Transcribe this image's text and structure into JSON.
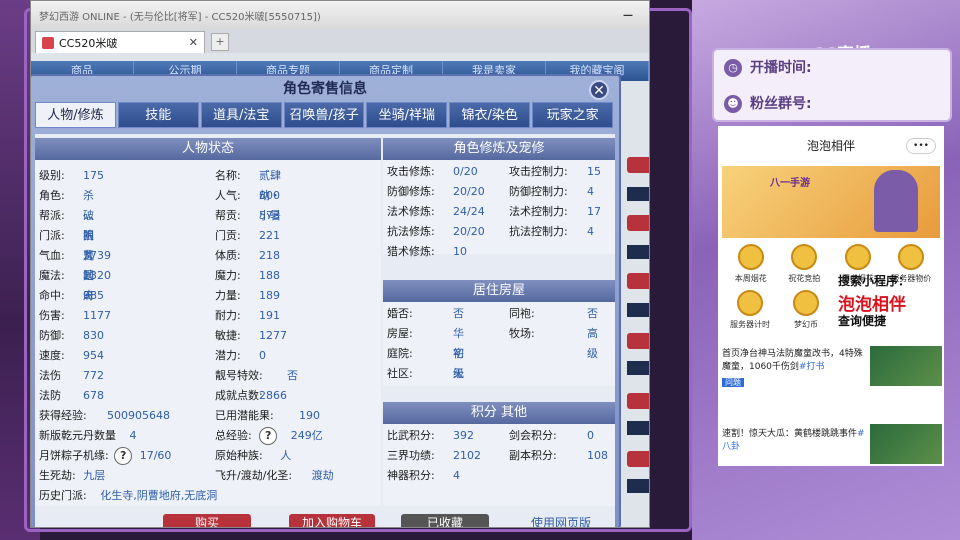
{
  "window": {
    "title": "梦幻西游 ONLINE - (无与伦比[将军] - CC520米啵[5550715])",
    "min_label": "—",
    "tab_label": "CC520米啵",
    "tab_close": "✕",
    "new_tab": "+"
  },
  "nav": [
    "商品",
    "公示期",
    "商品专题",
    "商品定制",
    "我是卖家",
    "我的藏宝阁"
  ],
  "dialog": {
    "title": "角色寄售信息",
    "close": "✕",
    "tabs": [
      "人物/修炼",
      "技能",
      "道具/法宝",
      "召唤兽/孩子",
      "坐骑/祥瑞",
      "锦衣/染色",
      "玩家之家"
    ]
  },
  "status": {
    "header": "人物状态",
    "left": [
      [
        "级别:",
        "175"
      ],
      [
        "角色:",
        "杀破狼"
      ],
      [
        "帮派:",
        "灬凼儿园ミ"
      ],
      [
        "门派:",
        "阴曹地府"
      ],
      [
        "气血:",
        "3739"
      ],
      [
        "魔法:",
        "1320"
      ],
      [
        "命中:",
        "985"
      ],
      [
        "伤害:",
        "1177"
      ],
      [
        "防御:",
        "830"
      ],
      [
        "速度:",
        "954"
      ],
      [
        "法伤",
        "772"
      ],
      [
        "法防",
        "678"
      ],
      [
        "获得经验:",
        "500905648"
      ]
    ],
    "right": [
      [
        "名称:",
        "贰肆劫・小暑"
      ],
      [
        "人气:",
        "800"
      ],
      [
        "帮贡:",
        "573"
      ],
      [
        "门贡:",
        "221"
      ],
      [
        "体质:",
        "218"
      ],
      [
        "魔力:",
        "188"
      ],
      [
        "力量:",
        "189"
      ],
      [
        "耐力:",
        "191"
      ],
      [
        "敏捷:",
        "1277"
      ],
      [
        "潜力:",
        "0"
      ],
      [
        "靓号特效:",
        "否"
      ],
      [
        "成就点数:",
        "2866"
      ],
      [
        "已用潜能果:",
        "190"
      ]
    ],
    "extra": [
      [
        "新版乾元丹数量",
        "4"
      ],
      [
        "总经验:",
        "249亿"
      ],
      [
        "月饼粽子机缘:",
        "17/60"
      ],
      [
        "原始种族:",
        "人"
      ],
      [
        "生死劫:",
        "九层"
      ],
      [
        "飞升/渡劫/化圣:",
        "渡劫"
      ]
    ],
    "history_label": "历史门派:",
    "history_value": "化生寺,阴曹地府,无底洞"
  },
  "cultivation": {
    "header": "角色修炼及宠修",
    "rows": [
      [
        "攻击修炼:",
        "0/20",
        "攻击控制力:",
        "15"
      ],
      [
        "防御修炼:",
        "20/20",
        "防御控制力:",
        "4"
      ],
      [
        "法术修炼:",
        "24/24",
        "法术控制力:",
        "17"
      ],
      [
        "抗法修炼:",
        "20/20",
        "抗法控制力:",
        "4"
      ],
      [
        "猎术修炼:",
        "10",
        "",
        ""
      ]
    ]
  },
  "housing": {
    "header": "居住房屋",
    "rows": [
      [
        "婚否:",
        "否",
        "同袍:",
        "否"
      ],
      [
        "房屋:",
        "华宅",
        "牧场:",
        "高级"
      ],
      [
        "庭院:",
        "初级",
        "",
        ""
      ],
      [
        "社区:",
        "无",
        "",
        ""
      ]
    ]
  },
  "points": {
    "header": "积分 其他",
    "rows": [
      [
        "比武积分:",
        "392",
        "剑会积分:",
        "0"
      ],
      [
        "三界功绩:",
        "2102",
        "副本积分:",
        "108"
      ],
      [
        "神器积分:",
        "4",
        "",
        ""
      ]
    ]
  },
  "buttons": {
    "buy": "购买",
    "cart": "加入购物车",
    "fav": "已收藏",
    "share": "使用网页版"
  },
  "help_mark": "?",
  "overlay": {
    "logo": "CC直播",
    "start_time": "开播时间:",
    "fan_group": "粉丝群号:",
    "clock_icon": "clock-icon",
    "group_icon": "group-icon",
    "phone_title": "泡泡相伴",
    "phone_dots": "•••",
    "banner_text": "八一手游",
    "icons": [
      "本周烟花",
      "祝花竞拍",
      "历史烟花",
      "服务器物价",
      "服务器计时",
      "梦幻币"
    ],
    "promo1": "搜索小程序：",
    "promo2": "泡泡相伴",
    "promo3": "查询便捷",
    "news1": "首页净台神马法防魔童改书，4特殊魔童，1060千伤剑",
    "news1_tag": "#打书",
    "news1_badge": "问题",
    "news2": "速割！惊天大瓜：黄鹤楼跳跳事件",
    "news2_tag": "#八卦",
    "colors": {
      "accent": "#b8323b",
      "overlay": "#5a3e83",
      "promo_red": "#d8141e"
    }
  }
}
